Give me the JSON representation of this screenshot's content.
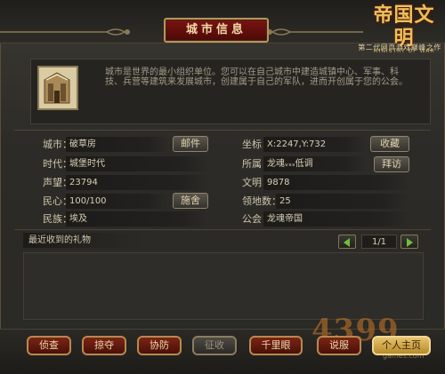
{
  "window": {
    "title": "城市信息"
  },
  "logo": {
    "main": "帝国文明",
    "sub": "MINISTRY OF WAR",
    "tagline": "第二代网页游戏巅峰之作"
  },
  "intro": {
    "text": "城市是世界的最小组织单位。您可以在自己城市中建造城镇中心、军事、科技、兵营等建筑来发展城市，创建属于自己的军队，进而开创属于您的公会。"
  },
  "left_fields": [
    {
      "label": "城市：",
      "value": "破草房",
      "button": "邮件"
    },
    {
      "label": "时代：",
      "value": "城堡时代"
    },
    {
      "label": "声望：",
      "value": "23794"
    },
    {
      "label": "民心：",
      "value": "100/100",
      "button": "施舍"
    },
    {
      "label": "民族：",
      "value": "埃及"
    }
  ],
  "right_fields": [
    {
      "label": "坐标：",
      "value": "X:2247,Y:732",
      "button": "收藏"
    },
    {
      "label": "所属：",
      "value": "龙魂ᵥₛₛ低调",
      "button": "拜访"
    },
    {
      "label": "文明：",
      "value": "9878"
    },
    {
      "label": "领地数：",
      "value": "25"
    },
    {
      "label": "公会：",
      "value": "龙魂帝国"
    }
  ],
  "gifts": {
    "label": "最近收到的礼物",
    "page": "1/1"
  },
  "actions": [
    {
      "label": "侦查",
      "state": "normal"
    },
    {
      "label": "掠夺",
      "state": "normal"
    },
    {
      "label": "协防",
      "state": "normal"
    },
    {
      "label": "征收",
      "state": "disabled"
    },
    {
      "label": "千里眼",
      "state": "normal"
    },
    {
      "label": "说服",
      "state": "normal"
    },
    {
      "label": "个人主页",
      "state": "highlight"
    }
  ],
  "watermark": {
    "main": "4399",
    "sub": "games.com"
  },
  "colors": {
    "accent_red": "#7b2416",
    "gold": "#e7c36a",
    "panel": "#2a2925",
    "border": "#b58a4e"
  },
  "icons": {
    "city": "city-building-icon",
    "prev": "arrow-left-icon",
    "next": "arrow-right-icon"
  }
}
